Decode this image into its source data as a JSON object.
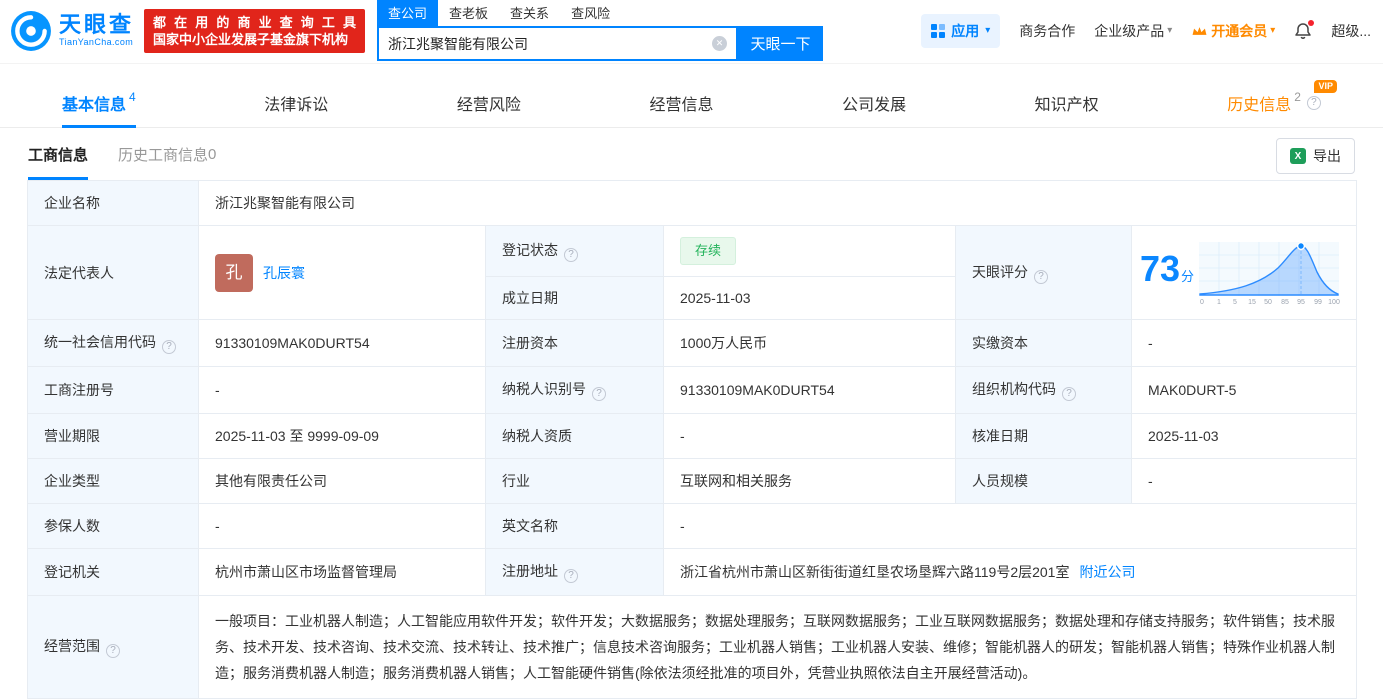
{
  "colors": {
    "brand_blue": "#0084ff",
    "banner_red": "#e1251b",
    "vip_orange": "#ff8a00",
    "status_green": "#23b35b",
    "label_cell_bg": "#f2f8fe"
  },
  "header": {
    "logo": {
      "title": "天眼查",
      "subtitle": "TianYanCha.com"
    },
    "banner": {
      "line1": "都在用的商业查询工具",
      "line2": "国家中小企业发展子基金旗下机构"
    },
    "search_tabs": [
      {
        "label": "查公司"
      },
      {
        "label": "查老板"
      },
      {
        "label": "查关系"
      },
      {
        "label": "查风险"
      }
    ],
    "search": {
      "value": "浙江兆聚智能有限公司",
      "button_label": "天眼一下"
    },
    "nav": {
      "apps": "应用",
      "cooperation": "商务合作",
      "enterprise": "企业级产品",
      "vip": "开通会员",
      "super": "超级..."
    }
  },
  "tabs": [
    {
      "label": "基本信息",
      "count": "4"
    },
    {
      "label": "法律诉讼"
    },
    {
      "label": "经营风险"
    },
    {
      "label": "经营信息"
    },
    {
      "label": "公司发展"
    },
    {
      "label": "知识产权"
    },
    {
      "label": "历史信息",
      "count": "2",
      "badge": "VIP"
    }
  ],
  "subtabs": {
    "active": "工商信息",
    "history": "历史工商信息",
    "history_count": "0",
    "export_label": "导出"
  },
  "table": {
    "company_name": {
      "label": "企业名称",
      "value": "浙江兆聚智能有限公司"
    },
    "legal_rep": {
      "label": "法定代表人",
      "value": "孔辰寰",
      "avatar": "孔"
    },
    "reg_status": {
      "label": "登记状态",
      "value": "存续"
    },
    "establish_date": {
      "label": "成立日期",
      "value": "2025-11-03"
    },
    "score": {
      "label": "天眼评分",
      "value": "73",
      "unit": "分",
      "ticks": [
        "0",
        "1",
        "5",
        "15",
        "50",
        "85",
        "95",
        "99",
        "100"
      ]
    },
    "credit_code": {
      "label": "统一社会信用代码",
      "value": "91330109MAK0DURT54"
    },
    "reg_capital": {
      "label": "注册资本",
      "value": "1000万人民币"
    },
    "paid_capital": {
      "label": "实缴资本",
      "value": "-"
    },
    "reg_number": {
      "label": "工商注册号",
      "value": "-"
    },
    "taxpayer_id": {
      "label": "纳税人识别号",
      "value": "91330109MAK0DURT54"
    },
    "org_code": {
      "label": "组织机构代码",
      "value": "MAK0DURT-5"
    },
    "business_term": {
      "label": "营业期限",
      "value": "2025-11-03 至 9999-09-09"
    },
    "taxpayer_quality": {
      "label": "纳税人资质",
      "value": "-"
    },
    "approval_date": {
      "label": "核准日期",
      "value": "2025-11-03"
    },
    "company_type": {
      "label": "企业类型",
      "value": "其他有限责任公司"
    },
    "industry": {
      "label": "行业",
      "value": "互联网和相关服务"
    },
    "staff_size": {
      "label": "人员规模",
      "value": "-"
    },
    "insured_count": {
      "label": "参保人数",
      "value": "-"
    },
    "english_name": {
      "label": "英文名称",
      "value": "-"
    },
    "reg_authority": {
      "label": "登记机关",
      "value": "杭州市萧山区市场监督管理局"
    },
    "reg_address": {
      "label": "注册地址",
      "value": "浙江省杭州市萧山区新街街道红垦农场垦辉六路119号2层201室",
      "link": "附近公司"
    },
    "business_scope": {
      "label": "经营范围",
      "value": "一般项目：工业机器人制造；人工智能应用软件开发；软件开发；大数据服务；数据处理服务；互联网数据服务；工业互联网数据服务；数据处理和存储支持服务；软件销售；技术服务、技术开发、技术咨询、技术交流、技术转让、技术推广；信息技术咨询服务；工业机器人销售；工业机器人安装、维修；智能机器人的研发；智能机器人销售；特殊作业机器人制造；服务消费机器人制造；服务消费机器人销售；人工智能硬件销售(除依法须经批准的项目外，凭营业执照依法自主开展经营活动)。"
    }
  }
}
